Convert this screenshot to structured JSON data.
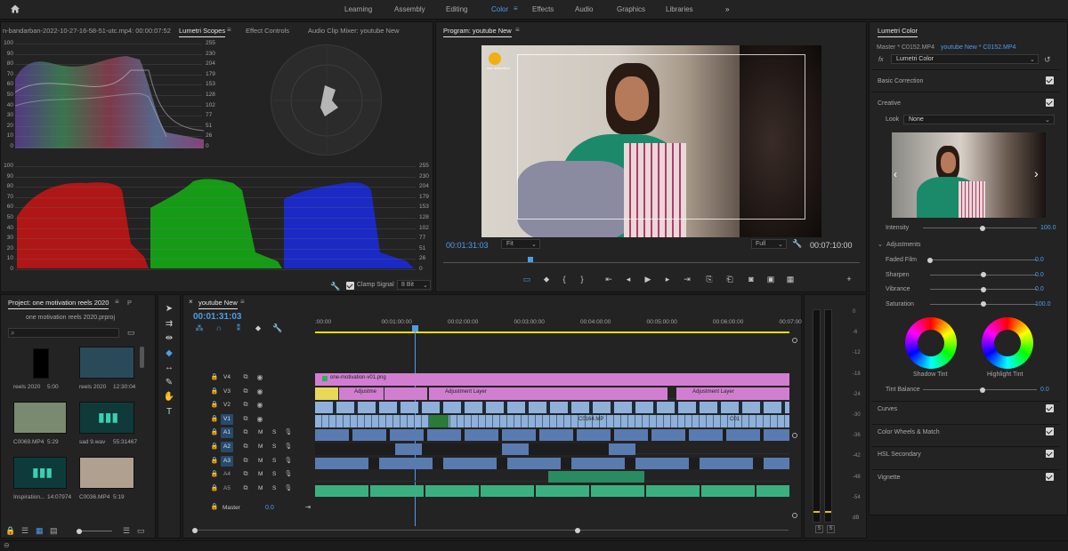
{
  "workspaces": [
    "Learning",
    "Assembly",
    "Editing",
    "Color",
    "Effects",
    "Audio",
    "Graphics",
    "Libraries"
  ],
  "active_workspace": "Color",
  "icons": {
    "home": "home-icon",
    "overflow": "double-chevron-right-icon"
  },
  "source_panel": {
    "tabs": [
      "n-bandarban-2022-10-27-16-58-51-utc.mp4: 00:00:07:52",
      "Lumetri Scopes",
      "Effect Controls",
      "Audio Clip Mixer: youtube New"
    ],
    "active_tab": "Lumetri Scopes",
    "waveform_left_ticks": [
      "100",
      "90",
      "80",
      "70",
      "60",
      "50",
      "40",
      "30",
      "20",
      "10",
      "0"
    ],
    "waveform_right_ticks": [
      "255",
      "230",
      "204",
      "179",
      "153",
      "128",
      "102",
      "77",
      "51",
      "26",
      "0"
    ],
    "clamp_signal": "Clamp Signal",
    "bit_depth": "8 Bit"
  },
  "program_monitor": {
    "title": "Program: youtube New",
    "timecode": "00:01:31:03",
    "fit": "Fit",
    "quality": "Full",
    "duration": "00:07:10:00",
    "watermark": "one motivation"
  },
  "lumetri": {
    "title": "Lumetri Color",
    "master": "Master * C0152.MP4",
    "sequence_clip": "youtube New * C0152.MP4",
    "fx_label": "fx",
    "effect": "Lumetri Color",
    "basic": "Basic Correction",
    "creative": "Creative",
    "look_label": "Look",
    "look_value": "None",
    "intensity_label": "Intensity",
    "intensity_value": "100.0",
    "adjustments": "Adjustments",
    "sliders": [
      {
        "label": "Faded Film",
        "value": "0.0",
        "pos": 0.0
      },
      {
        "label": "Sharpen",
        "value": "0.0",
        "pos": 0.5
      },
      {
        "label": "Vibrance",
        "value": "0.0",
        "pos": 0.5
      },
      {
        "label": "Saturation",
        "value": "100.0",
        "pos": 0.5
      }
    ],
    "shadow_tint": "Shadow Tint",
    "highlight_tint": "Highlight Tint",
    "tint_balance_label": "Tint Balance",
    "tint_balance_value": "0.0",
    "sections": [
      "Curves",
      "Color Wheels & Match",
      "HSL Secondary",
      "Vignette"
    ]
  },
  "project": {
    "tabs": [
      "Project: one motivation reels 2020",
      "P"
    ],
    "file": "one motivation reels 2020.prproj",
    "items": [
      {
        "name": "reels 2020",
        "dur": "5:00"
      },
      {
        "name": "reels 2020",
        "dur": "12:30:04"
      },
      {
        "name": "C0069.MP4",
        "dur": "5:29"
      },
      {
        "name": "sad 9.wav",
        "dur": "55:31467"
      },
      {
        "name": "Inspiration...",
        "dur": "14:07974"
      },
      {
        "name": "C0036.MP4",
        "dur": "5:19"
      }
    ]
  },
  "timeline": {
    "title": "youtube New",
    "timecode": "00:01:31:03",
    "ruler": [
      ":00:00",
      "00:01:00:00",
      "00:02:00:00",
      "00:03:00:00",
      "00:04:00:00",
      "00:05:00:00",
      "00:06:00:00",
      "00:07:00"
    ],
    "tracks": [
      "V4",
      "V3",
      "V2",
      "V1",
      "A1",
      "A2",
      "A3",
      "A4",
      "A5"
    ],
    "master_label": "Master",
    "master_value": "0.0",
    "clips": {
      "v4": "one-motivation-v01.png",
      "v3a": "Adjustme",
      "v3b": "Adjustment Layer",
      "v3c": "Adjustment Layer",
      "v1a": "C0164.MP",
      "v1b": "C01"
    },
    "track_btns": {
      "m": "M",
      "s": "S"
    }
  },
  "meters": {
    "db": [
      "0",
      "-6",
      "-12",
      "-18",
      "-24",
      "-30",
      "-36",
      "-42",
      "-48",
      "-54",
      "dB"
    ],
    "solo": [
      "S",
      "S"
    ]
  }
}
